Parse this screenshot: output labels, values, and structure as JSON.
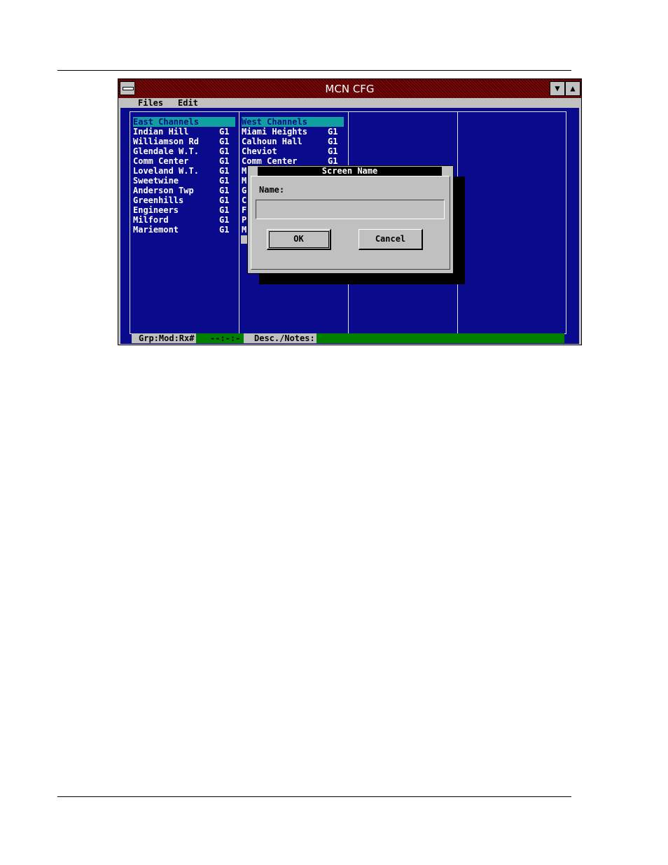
{
  "window": {
    "title": "MCN CFG",
    "min_glyph": "▼",
    "max_glyph": "▲"
  },
  "menu": {
    "files": "Files",
    "edit": "Edit"
  },
  "east": {
    "header": "East Channels",
    "rows": [
      {
        "name": "Indian Hill",
        "grp": "G1"
      },
      {
        "name": "Williamson Rd",
        "grp": "G1"
      },
      {
        "name": "Glendale W.T.",
        "grp": "G1"
      },
      {
        "name": "Comm Center",
        "grp": "G1"
      },
      {
        "name": "Loveland W.T.",
        "grp": "G1"
      },
      {
        "name": "Sweetwine",
        "grp": "G1"
      },
      {
        "name": "Anderson Twp",
        "grp": "G1"
      },
      {
        "name": "Greenhills",
        "grp": "G1"
      },
      {
        "name": "Engineers",
        "grp": "G1"
      },
      {
        "name": "Milford",
        "grp": "G1"
      },
      {
        "name": "Mariemont",
        "grp": "G1"
      }
    ]
  },
  "west": {
    "header": "West Channels",
    "rows": [
      {
        "name": "Miami Heights",
        "grp": "G1"
      },
      {
        "name": "Calhoun Hall",
        "grp": "G1"
      },
      {
        "name": "Cheviot",
        "grp": "G1"
      },
      {
        "name": "Comm Center",
        "grp": "G1"
      },
      {
        "name": "M",
        "grp": ""
      },
      {
        "name": "M",
        "grp": ""
      },
      {
        "name": "G",
        "grp": ""
      },
      {
        "name": "C",
        "grp": ""
      },
      {
        "name": "F",
        "grp": ""
      },
      {
        "name": "P",
        "grp": ""
      },
      {
        "name": "M",
        "grp": ""
      }
    ]
  },
  "status": {
    "grp_label": "Grp:Mod:Rx#",
    "grp_value": "--:-:-",
    "desc_label": "Desc./Notes:"
  },
  "dialog": {
    "title": "Screen Name",
    "name_label": "Name:",
    "name_value": "",
    "ok": "OK",
    "cancel": "Cancel"
  }
}
